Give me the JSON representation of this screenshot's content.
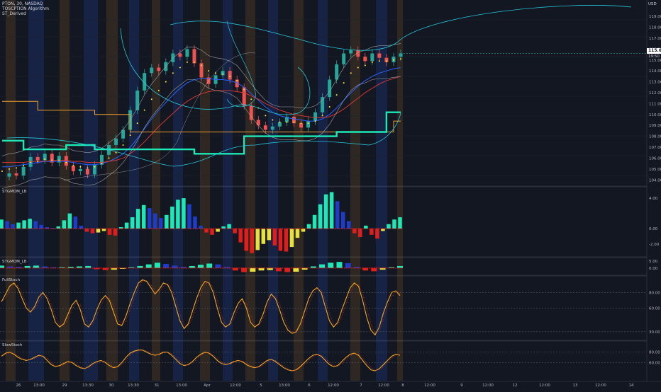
{
  "header": {
    "symbol_line": "PTON, 30, NASDAQ",
    "indicator_1": "TOSCPTION Algorithm",
    "indicator_2": "ST_Derived",
    "currency": "USD"
  },
  "panes": {
    "pane1_label": "STGMOM_LB",
    "pane2_label": "STGMOM_LB",
    "pane3_label": "FullStoch",
    "pane4_label": "SlowStoch"
  },
  "price_tag": {
    "value": "115.64",
    "countdown": "19:50"
  },
  "colors": {
    "background": "#131722",
    "band_orange": "#c47b1e",
    "band_blue": "#2962ff",
    "cyan_line": "#26c6da",
    "teal_level": "#1de9b6",
    "orange_level": "#f0a030",
    "hist_blue": "#1e3cc8",
    "hist_teal": "#1de9b6",
    "hist_red": "#e01e1e",
    "hist_yellow": "#e8e03c",
    "stoch_line": "#f5a623",
    "candle_up": "#26a69a",
    "candle_down": "#ef5350",
    "dot_yellow": "#ffeb3b"
  },
  "chart_data": [
    {
      "type": "line",
      "pane": "price",
      "ylim": [
        103.5,
        120.5
      ],
      "yticks": [
        104,
        105,
        106,
        107,
        108,
        109,
        110,
        111,
        112,
        113,
        114,
        115,
        116,
        117,
        118,
        119
      ],
      "ytick_labels": [
        "104.00",
        "105.00",
        "106.00",
        "107.00",
        "108.00",
        "109.00",
        "110.00",
        "111.00",
        "112.00",
        "113.00",
        "114.00",
        "115.00",
        "116.00",
        "117.00",
        "118.00",
        "119.00"
      ],
      "series": [
        {
          "values": [
            104.3,
            104.6,
            104.4,
            105.2,
            106.1,
            105.8,
            106.4,
            105.6,
            106.2,
            105.3,
            104.8,
            105.0,
            104.5,
            105.4,
            106.3,
            107.2,
            107.8,
            108.6,
            110.4,
            112.2,
            113.8,
            114.3,
            114.0,
            114.8,
            115.6,
            115.3,
            116.0,
            114.7,
            113.4,
            112.8,
            113.6,
            114.0,
            113.2,
            112.5,
            110.8,
            109.5,
            109.0,
            108.6,
            108.9,
            109.3,
            109.8,
            109.2,
            108.8,
            109.4,
            110.2,
            111.6,
            113.2,
            114.6,
            115.6,
            115.9,
            115.3,
            114.9,
            115.6,
            115.2,
            114.8,
            115.3,
            115.6
          ]
        },
        {
          "values": [
            104.8,
            105.0,
            105.1,
            105.3,
            105.6,
            105.7,
            105.9,
            105.8,
            105.8,
            105.6,
            105.3,
            105.2,
            105.1,
            105.2,
            105.5,
            106.0,
            106.5,
            107.2,
            108.1,
            109.2,
            110.4,
            111.4,
            112.2,
            113.0,
            113.8,
            114.3,
            114.8,
            114.8,
            114.5,
            114.0,
            113.8,
            113.7,
            113.5,
            113.1,
            112.3,
            111.4,
            110.6,
            109.9,
            109.5,
            109.3,
            109.3,
            109.3,
            109.2,
            109.2,
            109.4,
            109.9,
            110.7,
            111.8,
            112.9,
            113.8,
            114.3,
            114.5,
            114.8,
            114.9,
            114.9,
            115.0,
            115.1
          ]
        },
        {
          "values": [
            105.2,
            105.2,
            105.3,
            105.4,
            105.5,
            105.6,
            105.7,
            105.7,
            105.7,
            105.7,
            105.6,
            105.5,
            105.4,
            105.4,
            105.5,
            105.7,
            106.0,
            106.4,
            107.0,
            107.8,
            108.7,
            109.6,
            110.4,
            111.1,
            111.8,
            112.4,
            112.9,
            113.2,
            113.3,
            113.3,
            113.2,
            113.2,
            113.1,
            112.9,
            112.5,
            111.9,
            111.3,
            110.7,
            110.2,
            109.9,
            109.7,
            109.6,
            109.5,
            109.4,
            109.4,
            109.6,
            110.0,
            110.6,
            111.3,
            112.0,
            112.6,
            113.1,
            113.5,
            113.8,
            114.0,
            114.2,
            114.3
          ]
        },
        {
          "values": [
            105.6,
            105.6,
            105.6,
            105.6,
            105.7,
            105.7,
            105.7,
            105.8,
            105.8,
            105.8,
            105.7,
            105.7,
            105.6,
            105.6,
            105.6,
            105.7,
            105.8,
            106.0,
            106.4,
            106.9,
            107.5,
            108.2,
            108.9,
            109.5,
            110.1,
            110.7,
            111.2,
            111.6,
            111.9,
            112.1,
            112.2,
            112.2,
            112.2,
            112.1,
            112.0,
            111.7,
            111.4,
            111.0,
            110.7,
            110.4,
            110.2,
            110.0,
            109.9,
            109.8,
            109.7,
            109.7,
            109.8,
            110.1,
            110.5,
            111.0,
            111.5,
            112.0,
            112.4,
            112.8,
            113.1,
            113.3,
            113.5
          ]
        }
      ],
      "levels": [
        {
          "values": [
            111.2,
            111.2,
            111.2,
            111.2,
            111.2,
            110.4,
            110.4,
            110.4,
            110.4,
            110.4,
            110.4,
            110.4,
            110.4,
            110.0,
            110.0,
            110.0,
            110.0,
            110.0,
            108.4,
            108.4,
            108.4,
            108.4,
            108.4,
            108.4,
            108.4,
            108.4,
            108.4,
            108.4,
            108.4,
            108.4,
            108.4,
            108.4,
            108.4,
            108.4,
            108.4,
            108.4,
            108.4,
            108.4,
            108.4,
            108.4,
            108.4,
            108.4,
            108.4,
            108.4,
            108.4,
            108.4,
            108.4,
            108.4,
            108.4,
            108.4,
            108.4,
            108.4,
            108.4,
            108.4,
            108.4,
            109.4,
            109.4
          ]
        },
        {
          "values": [
            107.6,
            107.6,
            107.6,
            106.8,
            106.8,
            106.8,
            106.8,
            106.8,
            106.8,
            107.2,
            107.2,
            107.2,
            107.2,
            106.8,
            106.8,
            106.8,
            106.8,
            106.8,
            106.8,
            106.8,
            106.8,
            106.8,
            106.8,
            106.8,
            106.8,
            106.8,
            106.8,
            106.4,
            106.4,
            106.4,
            106.4,
            106.4,
            106.4,
            106.4,
            108.0,
            108.0,
            108.0,
            108.0,
            108.0,
            108.0,
            108.0,
            108.0,
            108.0,
            108.0,
            108.0,
            108.0,
            108.0,
            108.4,
            108.4,
            108.4,
            108.4,
            108.4,
            108.4,
            108.4,
            110.2,
            110.2,
            110.2
          ]
        }
      ]
    },
    {
      "type": "bar",
      "pane": "STGMOM_LB",
      "ylim": [
        -3.6,
        5.4
      ],
      "yticks": [
        4,
        0,
        -2
      ],
      "ytick_labels": [
        "4.00",
        "0.00",
        "-2.00"
      ],
      "values": [
        1.2,
        1.0,
        0.6,
        0.8,
        1.1,
        1.3,
        1.0,
        0.5,
        0.2,
        0.1,
        0.3,
        1.1,
        2.0,
        1.6,
        0.4,
        -0.4,
        -0.6,
        -0.5,
        -0.3,
        -0.8,
        -0.9,
        0.2,
        0.8,
        1.5,
        2.6,
        3.1,
        2.7,
        2.0,
        1.4,
        1.8,
        2.9,
        3.8,
        4.0,
        3.2,
        1.6,
        0.4,
        -0.5,
        -0.8,
        -0.4,
        0.3,
        0.6,
        -0.6,
        -1.8,
        -2.9,
        -3.2,
        -2.8,
        -2.0,
        -1.5,
        -2.2,
        -2.9,
        -3.0,
        -2.4,
        -1.2,
        -0.4,
        0.6,
        1.8,
        3.2,
        4.5,
        4.8,
        3.6,
        2.2,
        1.0,
        -0.6,
        -1.1,
        0.4,
        -0.8,
        -1.3,
        -0.3,
        0.6,
        1.2,
        1.5
      ]
    },
    {
      "type": "bar",
      "pane": "STGMOM_LB_2",
      "ylim": [
        -1.6,
        2.4
      ],
      "yticks": [
        0
      ],
      "ytick_labels": [
        "0.00"
      ],
      "extra_label": "5.00",
      "values": [
        0.6,
        0.4,
        0.3,
        0.5,
        0.6,
        0.4,
        0.2,
        0.2,
        0.3,
        0.4,
        0.5,
        -0.3,
        -0.5,
        -0.4,
        -0.2,
        0.2,
        0.5,
        0.9,
        1.3,
        1.0,
        0.6,
        0.3,
        0.5,
        0.8,
        1.1,
        0.9,
        0.3,
        -0.6,
        -1.0,
        -0.9,
        -0.6,
        -0.5,
        -0.8,
        -1.0,
        -0.9,
        -0.4,
        0.4,
        0.9,
        1.3,
        1.5,
        1.2,
        0.3,
        -0.6,
        -0.8,
        -0.4,
        0.2,
        0.5
      ]
    },
    {
      "type": "line",
      "pane": "FullStoch",
      "ylim": [
        20,
        100
      ],
      "yticks": [
        80,
        60,
        30
      ],
      "ytick_labels": [
        "80.00",
        "60.00",
        "30.00"
      ],
      "series": [
        {
          "values": [
            68,
            78,
            88,
            92,
            85,
            72,
            60,
            55,
            62,
            74,
            80,
            72,
            58,
            42,
            36,
            40,
            52,
            64,
            70,
            58,
            40,
            36,
            44,
            58,
            70,
            76,
            70,
            55,
            40,
            38,
            50,
            66,
            80,
            92,
            96,
            94,
            86,
            78,
            84,
            92,
            90,
            80,
            62,
            44,
            34,
            40,
            56,
            72,
            86,
            94,
            92,
            80,
            60,
            42,
            36,
            40,
            54,
            66,
            72,
            60,
            42,
            36,
            40,
            52,
            68,
            78,
            72,
            58,
            42,
            32,
            28,
            30,
            40,
            56,
            72,
            82,
            86,
            80,
            62,
            44,
            36,
            42,
            58,
            72,
            86,
            92,
            88,
            70,
            48,
            32,
            26,
            36,
            54,
            68,
            80,
            82,
            76
          ]
        }
      ]
    },
    {
      "type": "line",
      "pane": "SlowStoch",
      "ylim": [
        25,
        100
      ],
      "yticks": [
        80,
        60
      ],
      "ytick_labels": [
        "80.00",
        "60.00"
      ],
      "series": [
        {
          "values": [
            72,
            78,
            80,
            76,
            70,
            66,
            64,
            66,
            70,
            74,
            72,
            64,
            56,
            52,
            54,
            58,
            62,
            60,
            54,
            50,
            48,
            52,
            58,
            62,
            64,
            60,
            54,
            50,
            52,
            60,
            70,
            78,
            82,
            84,
            84,
            80,
            76,
            74,
            76,
            80,
            80,
            74,
            66,
            58,
            54,
            56,
            62,
            70,
            76,
            80,
            78,
            72,
            64,
            58,
            56,
            58,
            62,
            64,
            62,
            56,
            52,
            50,
            52,
            58,
            64,
            66,
            62,
            56,
            50,
            46,
            44,
            46,
            52,
            60,
            68,
            74,
            76,
            72,
            64,
            56,
            52,
            54,
            62,
            70,
            76,
            78,
            74,
            64,
            54,
            46,
            44,
            48,
            56,
            64,
            72,
            76,
            74
          ]
        }
      ]
    }
  ],
  "x_axis": {
    "labels": [
      "26",
      "13:00",
      "29",
      "13:30",
      "30",
      "13:30",
      "31",
      "13:00",
      "Apr",
      "12:00",
      "5",
      "13:00",
      "6",
      "12:00",
      "7",
      "12:00",
      "8",
      "12:00",
      "9",
      "12:00",
      "12",
      "12:00",
      "13",
      "12:00",
      "14"
    ]
  }
}
